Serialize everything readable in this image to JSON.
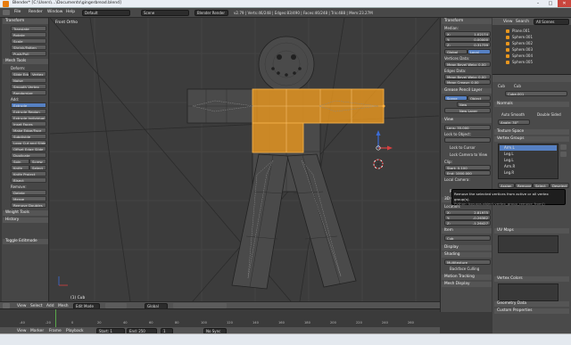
{
  "window": {
    "title": "Blender* [C:\\Users\\...\\Documents\\gingerbread.blend]",
    "buttons": [
      "–",
      "□",
      "✕"
    ]
  },
  "topbar": {
    "menus": [
      "File",
      "Render",
      "Window",
      "Help"
    ],
    "layout": "Default",
    "scene": "Scene",
    "engine": "Blender Render",
    "stats": "v2.79 | Verts:46/248 | Edges:83/490 | Faces:46/248 | Tris:488 | Mem:23.27M"
  },
  "toolshelf": {
    "transform_header": "Transform",
    "transform_buttons": [
      "Translate",
      "Rotate",
      "Scale",
      "Shrink/Fatten",
      "Push/Pull"
    ],
    "mesh_tools_header": "Mesh Tools",
    "deform_label": "Deform:",
    "deform_buttons": [
      "Slide Edge",
      "Vertex",
      "Noise",
      "Smooth Vertex",
      "Randomize"
    ],
    "add_label": "Add:",
    "extrude_select": "Extrude",
    "add_buttons": [
      "Extrude Region",
      "Extrude Individual",
      "Inset Faces",
      "Make Edge/Face",
      "Subdivide",
      "Loop Cut and Slide",
      "Offset Edge Slide",
      "Duplicate",
      "Spin",
      "Screw",
      "Knife",
      "Select",
      "Knife Project",
      "Bisect"
    ],
    "remove_label": "Remove:",
    "remove_buttons": [
      "Delete",
      "Merge",
      "Remove Doubles"
    ],
    "weight_tools": "Weight Tools",
    "history": "History",
    "operator": "Toggle Editmode"
  },
  "viewport": {
    "view_label": "Front Ortho",
    "object_label": "(1) Cub",
    "header_menus": [
      "View",
      "Select",
      "Add",
      "Mesh"
    ],
    "mode": "Edit Mode",
    "pivot": "Global"
  },
  "npanel": {
    "transform_header": "Transform",
    "median_label": "Median:",
    "median": [
      "X:",
      "1.02174",
      "Y:",
      "0.00000",
      "Z:",
      "0.31739"
    ],
    "global_local": [
      "Global",
      "Local"
    ],
    "vertex_data": "Vertices Data:",
    "bevel_weight": "Mean Bevel Weig: 0.00",
    "edges_data": "Edges Data:",
    "edge_bevel": "Mean Bevel Weig: 0.00",
    "crease": "Mean Crease: 0.00",
    "grease_pencil": "Grease Pencil Layer",
    "scene_object": [
      "Scene",
      "Object"
    ],
    "new": "New",
    "new_layer": "New Layer",
    "view_header": "View",
    "lens": "Lens: 35.000",
    "lock_object": "Lock to Object:",
    "lock_cursor": "Lock to Cursor",
    "lock_camera": "Lock Camera to View",
    "clip": "Clip:",
    "clip_start": "Start: 0.100",
    "clip_end": "End: 1000.000",
    "local_camera": "Local Camera:",
    "render_border": "Render Border",
    "cursor_header": "3D Cursor",
    "location": "Location:",
    "cursor": [
      "X:",
      "2.81975",
      "Y:",
      "-0.26382",
      "Z:",
      "-1.26427"
    ],
    "item_header": "Item",
    "item_name": "Cub",
    "display": "Display",
    "shading": "Shading",
    "shading_mode": "Multitexture",
    "backface": "Backface Culling",
    "motion_tracking": "Motion Tracking",
    "mesh_display": "Mesh Display"
  },
  "outliner": {
    "menus": [
      "View",
      "Search"
    ],
    "filter": "All Scenes",
    "items": [
      "Plane.001",
      "Sphere.001",
      "Sphere.002",
      "Sphere.003",
      "Sphere.004",
      "Sphere.005"
    ]
  },
  "properties": {
    "breadcrumb": [
      "Cub",
      "Cub"
    ],
    "data_name": "Cube.001",
    "normals": "Normals",
    "auto_smooth": "Auto Smooth",
    "double_sided": "Double Sided",
    "angle": "Angle: 30°",
    "texture_space": "Texture Space",
    "vertex_groups": "Vertex Groups",
    "groups": [
      "Arm.L",
      "Leg.L",
      "Leg.L",
      "Arm.R",
      "Leg.R"
    ],
    "assign": "Assign",
    "remove": "Remove",
    "select": "Select",
    "deselect": "Deselect",
    "uv_maps": "UV Maps",
    "vertex_colors": "Vertex Colors",
    "geometry_data": "Geometry Data",
    "custom_props": "Custom Properties"
  },
  "tooltip": {
    "line1": "Remove the selected vertices from active or all vertex group(s).",
    "line2": "Python: bpy.ops.object.vertex_group_remove_from()"
  },
  "timeline": {
    "ticks": [
      "-40",
      "-20",
      "0",
      "20",
      "40",
      "60",
      "80",
      "100",
      "120",
      "140",
      "160",
      "180",
      "200",
      "220",
      "240",
      "260"
    ],
    "menus": [
      "View",
      "Marker",
      "Frame",
      "Playback"
    ],
    "start": "Start: 1",
    "end": "End: 250",
    "current": "1",
    "sync": "No Sync"
  },
  "colors": {
    "accent": "#e8961e",
    "selection": "#5680c2"
  }
}
